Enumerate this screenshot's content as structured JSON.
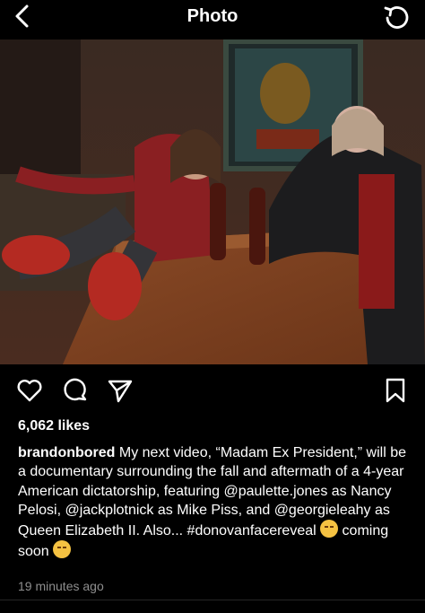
{
  "header": {
    "title": "Photo",
    "back_icon": "chevron-left-icon",
    "refresh_icon": "refresh-icon"
  },
  "post": {
    "likes": "6,062 likes",
    "username": "brandonbored",
    "caption": " My next video, “Madam Ex President,” will be a documentary surrounding the fall and aftermath of a 4-year American dictatorship, featuring @paulette.jones as Nancy Pelosi, @jackplotnick as Mike Piss, and @georgieleahy as Queen Elizabeth II. Also... #donovanfacereveal ",
    "caption_emoji_1": "smirking-face-emoji",
    "caption_tail": " coming soon ",
    "caption_emoji_2": "shushing-face-emoji",
    "timestamp": "19 minutes ago"
  },
  "actions": {
    "like_icon": "heart-icon",
    "comment_icon": "comment-icon",
    "share_icon": "send-icon",
    "save_icon": "bookmark-icon"
  },
  "colors": {
    "background": "#000000",
    "text": "#ffffff",
    "muted": "#8e8e8e"
  }
}
